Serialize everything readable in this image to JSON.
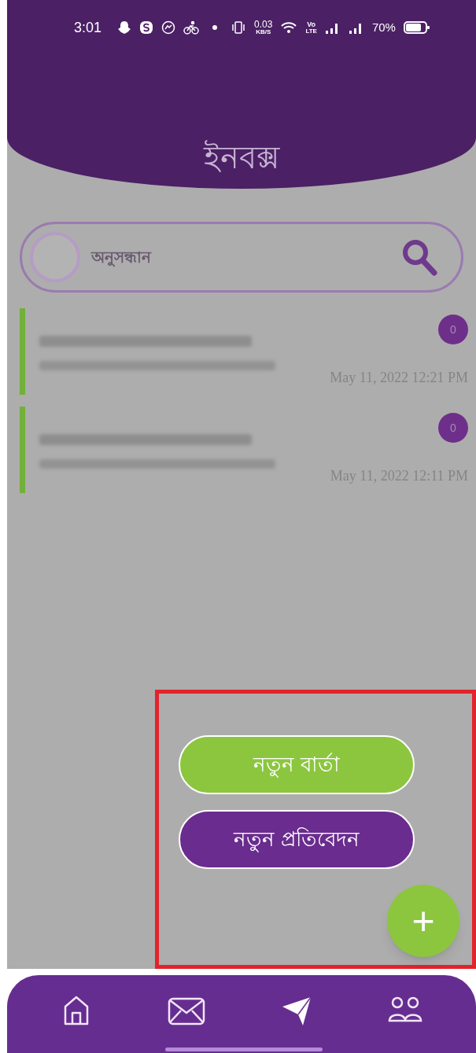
{
  "status_bar": {
    "time": "3:01",
    "speed_value": "0.03",
    "speed_unit": "KB/S",
    "volte_top": "Vo",
    "volte_bottom": "LTE",
    "battery": "70%"
  },
  "header": {
    "title": "ইনবক্স"
  },
  "search": {
    "placeholder": "অনুসন্ধান"
  },
  "messages": [
    {
      "count": "0",
      "time": "May 11, 2022 12:21 PM"
    },
    {
      "count": "0",
      "time": "May 11, 2022 12:11 PM"
    }
  ],
  "fab_menu": {
    "expanded": true,
    "actions": [
      {
        "label": "নতুন বার্তা",
        "kind": "green"
      },
      {
        "label": "নতুন প্রতিবেদন",
        "kind": "purple"
      }
    ],
    "main": "+"
  },
  "bottom_nav": [
    {
      "kind": "home"
    },
    {
      "kind": "mail"
    },
    {
      "kind": "send"
    },
    {
      "kind": "people"
    }
  ]
}
